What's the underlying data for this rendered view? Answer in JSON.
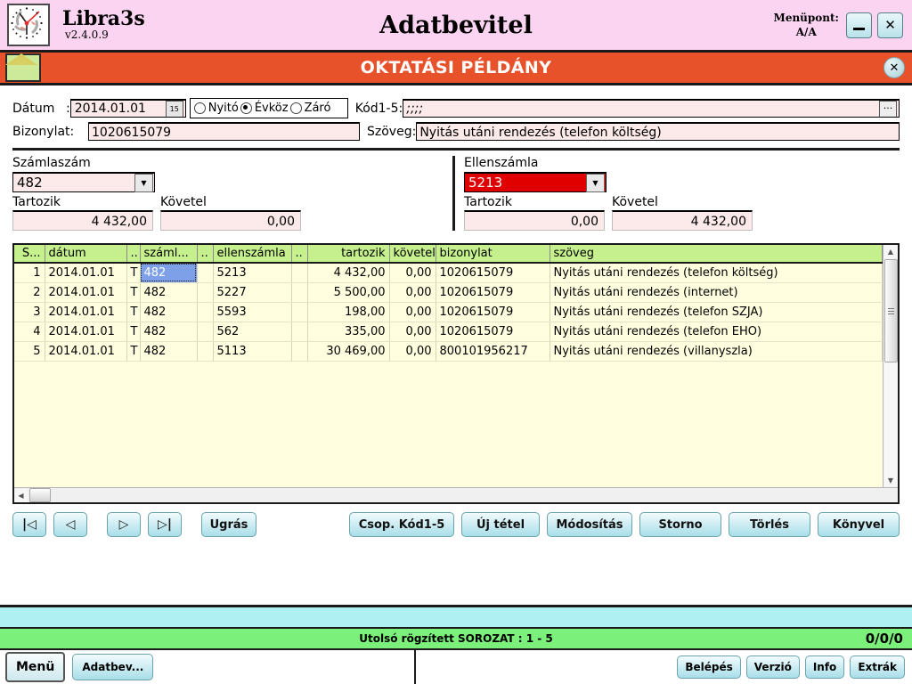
{
  "titlebar": {
    "logo_icon": "clock-logo-icon",
    "brand_name": "Libra3s",
    "brand_version": "v2.4.0.9",
    "app_title": "Adatbevitel",
    "menupoint_label": "Menüpont:",
    "menupoint_value": "A/A",
    "minimize_label": "_",
    "close_label": "✕",
    "bg_color": "#fbd4f2"
  },
  "banner": {
    "icon": "envelope-icon",
    "title": "OKTATÁSI PÉLDÁNY",
    "close_label": "✕",
    "bg_color": "#e8522b"
  },
  "form": {
    "datum_label": "Dátum",
    "datum_colon": ":",
    "datum_value": "2014.01.01",
    "calendar_icon": "calendar-icon",
    "period_options": [
      {
        "label": "Nyitó",
        "selected": false
      },
      {
        "label": "Évköz",
        "selected": true
      },
      {
        "label": "Záró",
        "selected": false
      }
    ],
    "kod_label": "Kód1-5:",
    "kod_value": ";;;;",
    "kod_more_label": "···",
    "bizonylat_label": "Bizonylat:",
    "bizonylat_value": "1020615079",
    "szoveg_label": "Szöveg:",
    "szoveg_value": "Nyitás utáni rendezés (telefon költség)"
  },
  "accounts": {
    "left": {
      "title": "Számlaszám",
      "value": "482",
      "highlighted": false,
      "debit_label": "Tartozik",
      "debit_value": "4 432,00",
      "credit_label": "Követel",
      "credit_value": "0,00"
    },
    "right": {
      "title": "Ellenszámla",
      "value": "5213",
      "highlighted": true,
      "highlight_color": "#e00000",
      "debit_label": "Tartozik",
      "debit_value": "0,00",
      "credit_label": "Követel",
      "credit_value": "4 432,00"
    }
  },
  "grid": {
    "headers": [
      "S...",
      "dátum",
      "..",
      "száml...",
      "..",
      "ellenszámla",
      "..",
      "tartozik",
      "követel",
      "bizonylat",
      "szöveg"
    ],
    "rows": [
      {
        "s": "1",
        "datum": "2014.01.01",
        "t": "T",
        "szamla": "482",
        "e1": "",
        "ellenszamla": "5213",
        "e2": "",
        "tartozik": "4 432,00",
        "kovetel": "0,00",
        "bizonylat": "1020615079",
        "szoveg": "Nyitás utáni rendezés (telefon költség)",
        "selected": true
      },
      {
        "s": "2",
        "datum": "2014.01.01",
        "t": "T",
        "szamla": "482",
        "e1": "",
        "ellenszamla": "5227",
        "e2": "",
        "tartozik": "5 500,00",
        "kovetel": "0,00",
        "bizonylat": "1020615079",
        "szoveg": "Nyitás utáni rendezés (internet)",
        "selected": false
      },
      {
        "s": "3",
        "datum": "2014.01.01",
        "t": "T",
        "szamla": "482",
        "e1": "",
        "ellenszamla": "5593",
        "e2": "",
        "tartozik": "198,00",
        "kovetel": "0,00",
        "bizonylat": "1020615079",
        "szoveg": "Nyitás utáni rendezés (telefon SZJA)",
        "selected": false
      },
      {
        "s": "4",
        "datum": "2014.01.01",
        "t": "T",
        "szamla": "482",
        "e1": "",
        "ellenszamla": "562",
        "e2": "",
        "tartozik": "335,00",
        "kovetel": "0,00",
        "bizonylat": "1020615079",
        "szoveg": "Nyitás utáni rendezés (telefon EHO)",
        "selected": false
      },
      {
        "s": "5",
        "datum": "2014.01.01",
        "t": "T",
        "szamla": "482",
        "e1": "",
        "ellenszamla": "5113",
        "e2": "",
        "tartozik": "30 469,00",
        "kovetel": "0,00",
        "bizonylat": "800101956217",
        "szoveg": "Nyitás utáni rendezés (villanyszla)",
        "selected": false
      }
    ]
  },
  "toolbar": {
    "first_label": "|◁",
    "prev_label": "◁",
    "next_label": "▷",
    "last_label": "▷|",
    "ugras_label": "Ugrás",
    "csop_label": "Csop. Kód1-5",
    "uj_tetel_label": "Új tétel",
    "modositas_label": "Módosítás",
    "storno_label": "Storno",
    "torles_label": "Törlés",
    "konyvel_label": "Könyvel"
  },
  "status": {
    "text": "Utolsó rögzített SOROZAT : 1 - 5",
    "counter": "0/0/0",
    "bg_color": "#7bf07b"
  },
  "bottombar": {
    "menu_label": "Menü",
    "tab_label": "Adatbev...",
    "belepes_label": "Belépés",
    "verzio_label": "Verzió",
    "info_label": "Info",
    "extrak_label": "Extrák"
  }
}
